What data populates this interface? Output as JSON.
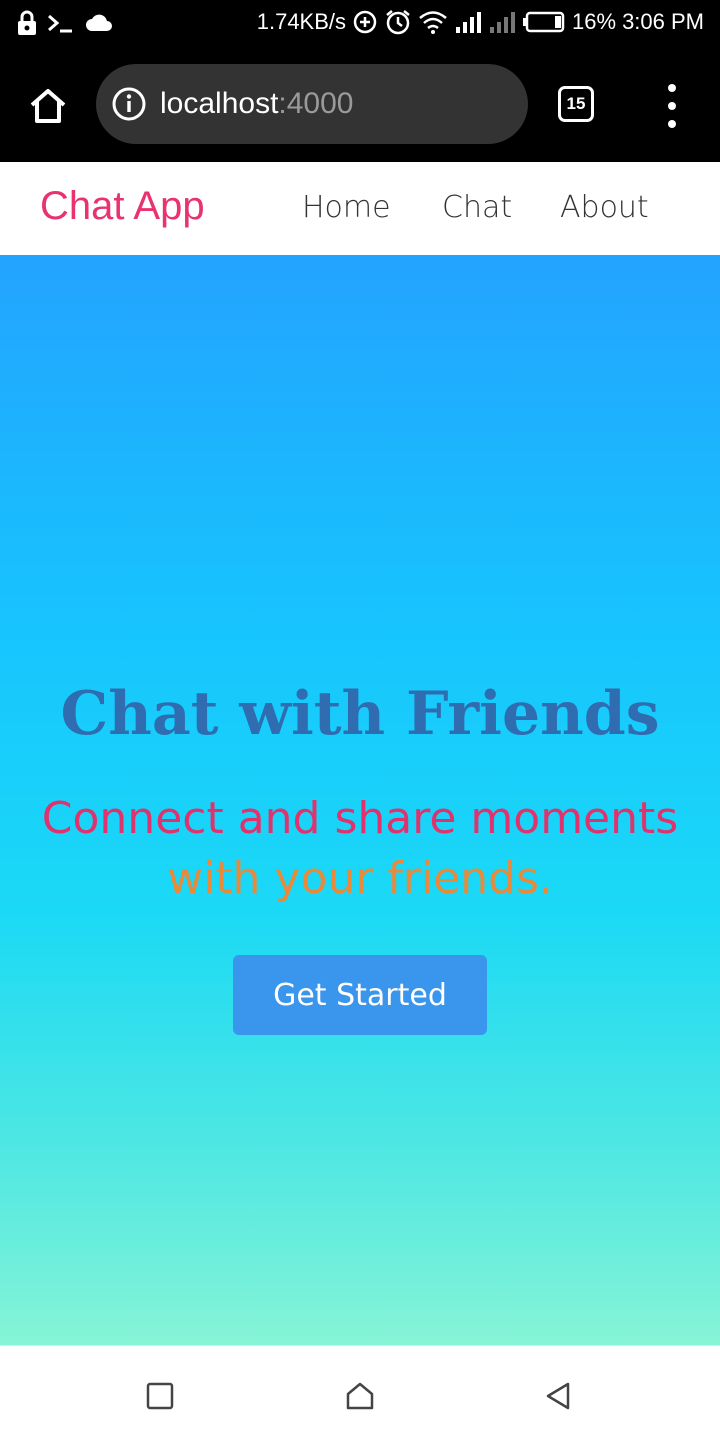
{
  "status_bar": {
    "net_speed": "1.74KB/s",
    "battery": "16%",
    "time": "3:06 PM"
  },
  "browser": {
    "url_host": "localhost",
    "url_port": ":4000",
    "tab_count": "15"
  },
  "navbar": {
    "brand": "Chat App",
    "links": [
      "Home",
      "Chat",
      "About"
    ]
  },
  "hero": {
    "title": "Chat with Friends",
    "subtitle_line1": "Connect and share moments",
    "subtitle_line2": "with your friends.",
    "cta_label": "Get Started"
  },
  "colors": {
    "brand": "#e8336f",
    "title": "#2f6db0",
    "cta_bg": "#3a95ec",
    "gradient_top": "#23a3ff",
    "gradient_bottom": "#86f4d6"
  }
}
